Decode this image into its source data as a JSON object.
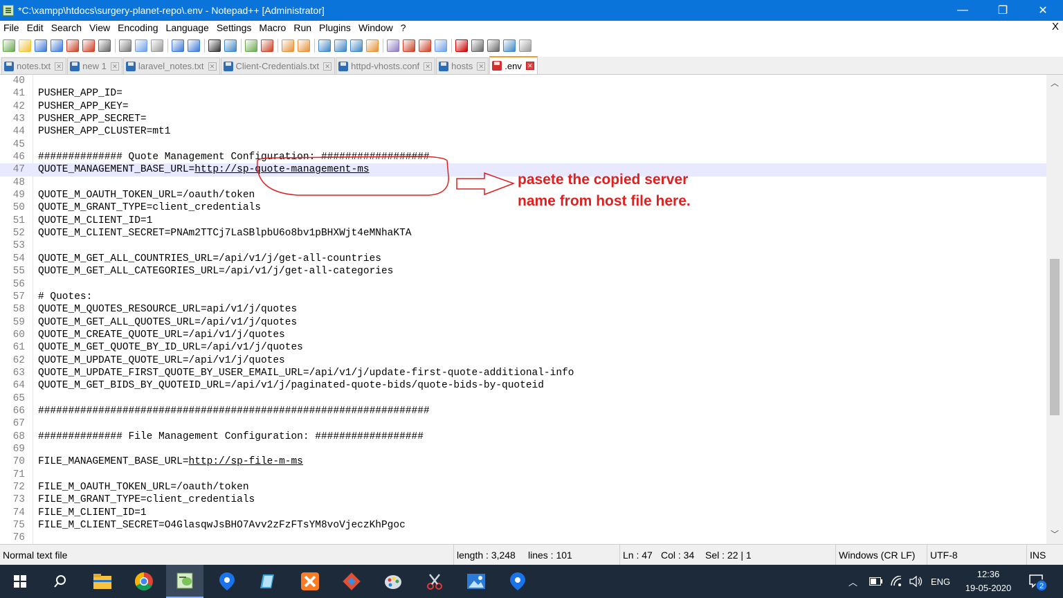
{
  "window": {
    "title": "*C:\\xampp\\htdocs\\surgery-planet-repo\\.env - Notepad++ [Administrator]",
    "minimize": "—",
    "maximize": "❐",
    "close": "✕"
  },
  "menu": {
    "items": [
      "File",
      "Edit",
      "Search",
      "View",
      "Encoding",
      "Language",
      "Settings",
      "Macro",
      "Run",
      "Plugins",
      "Window",
      "?"
    ],
    "close": "X"
  },
  "toolbar": {
    "icons": [
      "new-file-icon",
      "open-file-icon",
      "save-icon",
      "save-all-icon",
      "close-icon",
      "close-all-icon",
      "print-icon",
      "cut-icon",
      "copy-icon",
      "paste-icon",
      "undo-icon",
      "redo-icon",
      "find-icon",
      "replace-icon",
      "zoom-in-icon",
      "zoom-out-icon",
      "sync-vertical-icon",
      "sync-horizontal-icon",
      "word-wrap-icon",
      "show-all-chars-icon",
      "indent-guide-icon",
      "language-icon",
      "document-map-icon",
      "function-list-icon",
      "folder-workspace-icon",
      "monitor-icon",
      "record-macro-icon",
      "stop-macro-icon",
      "play-macro-icon",
      "run-macro-multiple-icon",
      "save-macro-icon"
    ]
  },
  "tabs": [
    {
      "label": "notes.txt",
      "active": false
    },
    {
      "label": "new 1",
      "active": false
    },
    {
      "label": "laravel_notes.txt",
      "active": false
    },
    {
      "label": "Client-Credentials.txt",
      "active": false
    },
    {
      "label": "httpd-vhosts.conf",
      "active": false
    },
    {
      "label": "hosts",
      "active": false
    },
    {
      "label": ".env",
      "active": true
    }
  ],
  "editor": {
    "lines": [
      {
        "n": "40",
        "t": ""
      },
      {
        "n": "41",
        "t": "PUSHER_APP_ID="
      },
      {
        "n": "42",
        "t": "PUSHER_APP_KEY="
      },
      {
        "n": "43",
        "t": "PUSHER_APP_SECRET="
      },
      {
        "n": "44",
        "t": "PUSHER_APP_CLUSTER=mt1"
      },
      {
        "n": "45",
        "t": ""
      },
      {
        "n": "46",
        "t": "############## Quote Management Configuration: ##################"
      },
      {
        "n": "47",
        "t": "QUOTE_MANAGEMENT_BASE_URL=",
        "url": "http://sp-quote-management-ms"
      },
      {
        "n": "48",
        "t": ""
      },
      {
        "n": "49",
        "t": "QUOTE_M_OAUTH_TOKEN_URL=/oauth/token"
      },
      {
        "n": "50",
        "t": "QUOTE_M_GRANT_TYPE=client_credentials"
      },
      {
        "n": "51",
        "t": "QUOTE_M_CLIENT_ID=1"
      },
      {
        "n": "52",
        "t": "QUOTE_M_CLIENT_SECRET=PNAm2TTCj7LaSBlpbU6o8bv1pBHXWjt4eMNhaKTA"
      },
      {
        "n": "53",
        "t": ""
      },
      {
        "n": "54",
        "t": "QUOTE_M_GET_ALL_COUNTRIES_URL=/api/v1/j/get-all-countries"
      },
      {
        "n": "55",
        "t": "QUOTE_M_GET_ALL_CATEGORIES_URL=/api/v1/j/get-all-categories"
      },
      {
        "n": "56",
        "t": ""
      },
      {
        "n": "57",
        "t": "# Quotes:"
      },
      {
        "n": "58",
        "t": "QUOTE_M_QUOTES_RESOURCE_URL=api/v1/j/quotes"
      },
      {
        "n": "59",
        "t": "QUOTE_M_GET_ALL_QUOTES_URL=/api/v1/j/quotes"
      },
      {
        "n": "60",
        "t": "QUOTE_M_CREATE_QUOTE_URL=/api/v1/j/quotes"
      },
      {
        "n": "61",
        "t": "QUOTE_M_GET_QUOTE_BY_ID_URL=/api/v1/j/quotes"
      },
      {
        "n": "62",
        "t": "QUOTE_M_UPDATE_QUOTE_URL=/api/v1/j/quotes"
      },
      {
        "n": "63",
        "t": "QUOTE_M_UPDATE_FIRST_QUOTE_BY_USER_EMAIL_URL=/api/v1/j/update-first-quote-additional-info"
      },
      {
        "n": "64",
        "t": "QUOTE_M_GET_BIDS_BY_QUOTEID_URL=/api/v1/j/paginated-quote-bids/quote-bids-by-quoteid"
      },
      {
        "n": "65",
        "t": ""
      },
      {
        "n": "66",
        "t": "#################################################################"
      },
      {
        "n": "67",
        "t": ""
      },
      {
        "n": "68",
        "t": "############## File Management Configuration: ##################"
      },
      {
        "n": "69",
        "t": ""
      },
      {
        "n": "70",
        "t": "FILE_MANAGEMENT_BASE_URL=",
        "url": "http://sp-file-m-ms"
      },
      {
        "n": "71",
        "t": ""
      },
      {
        "n": "72",
        "t": "FILE_M_OAUTH_TOKEN_URL=/oauth/token"
      },
      {
        "n": "73",
        "t": "FILE_M_GRANT_TYPE=client_credentials"
      },
      {
        "n": "74",
        "t": "FILE_M_CLIENT_ID=1"
      },
      {
        "n": "75",
        "t": "FILE_M_CLIENT_SECRET=O4GlasqwJsBHO7Avv2zFzFTsYM8voVjeczKhPgoc"
      },
      {
        "n": "76",
        "t": ""
      }
    ],
    "current_line": "47"
  },
  "annotation": {
    "line1": "pasete the copied server",
    "line2": "name from host file here.",
    "color": "#e02020"
  },
  "status": {
    "file_type": "Normal text file",
    "length": "length : 3,248",
    "lines": "lines : 101",
    "ln": "Ln : 47",
    "col": "Col : 34",
    "sel": "Sel : 22 | 1",
    "eol": "Windows (CR LF)",
    "encoding": "UTF-8",
    "mode": "INS"
  },
  "taskbar": {
    "apps": [
      "start-icon",
      "search-icon",
      "file-explorer-icon",
      "chrome-icon",
      "notepad-plus-plus-icon",
      "maps-pin-icon",
      "editor-icon",
      "xampp-icon",
      "git-icon",
      "paint-icon",
      "snipping-tool-icon",
      "photos-icon",
      "maps-pin-icon-2"
    ],
    "lang": "ENG",
    "time": "12:36",
    "date": "19-05-2020",
    "notifications": "2"
  }
}
